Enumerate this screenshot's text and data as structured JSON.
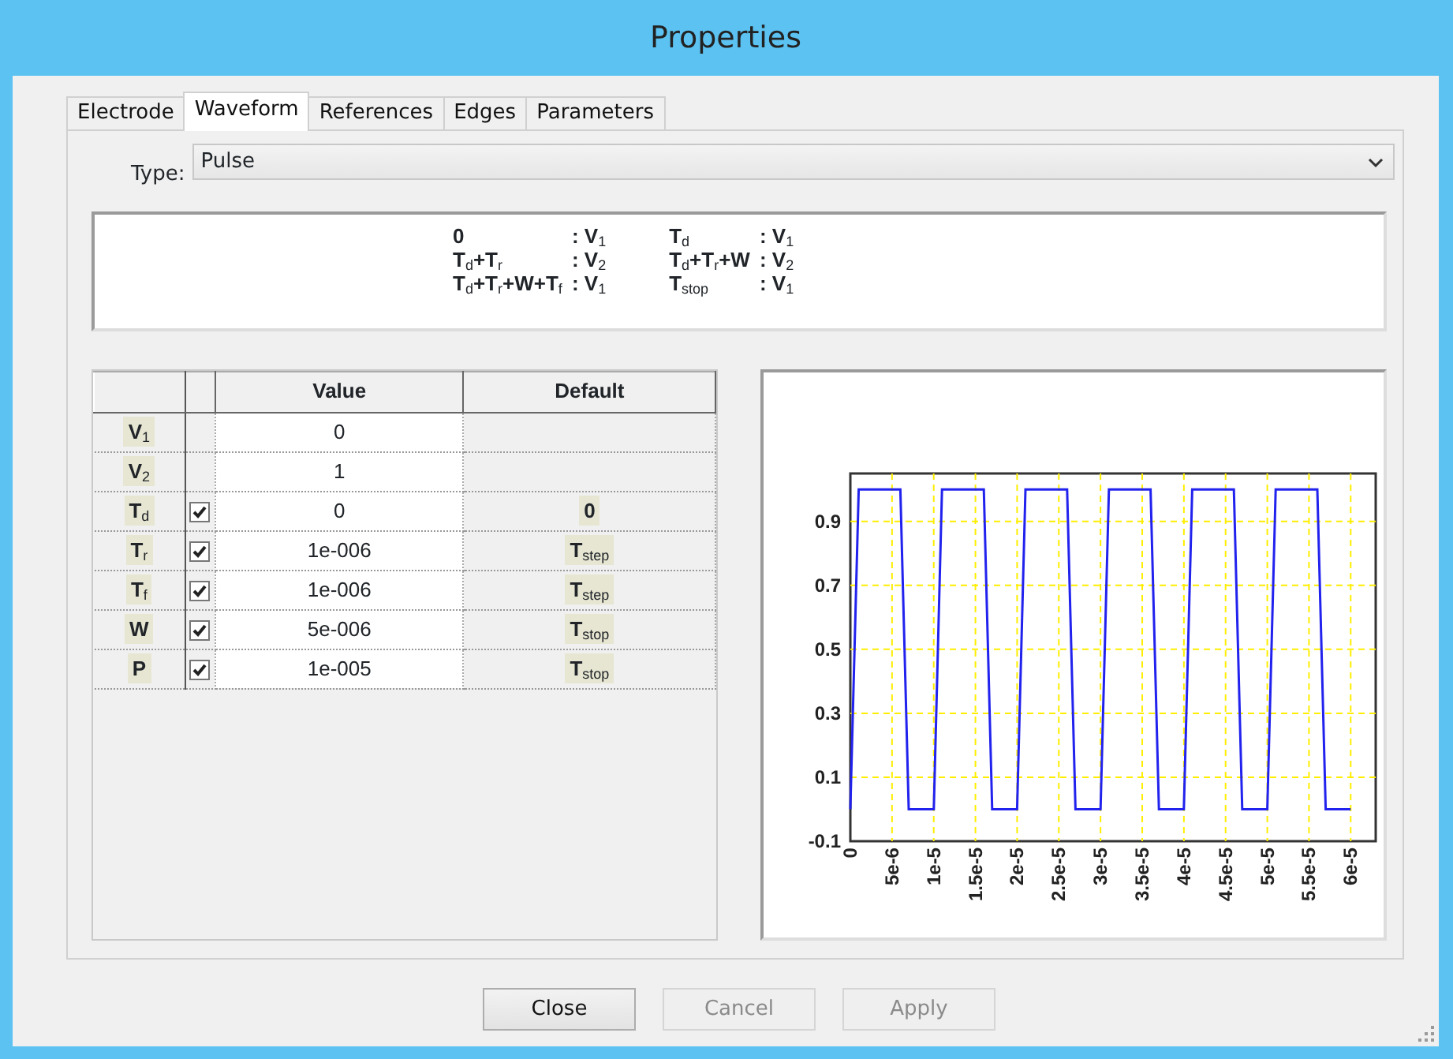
{
  "window": {
    "title": "Properties"
  },
  "tabs": [
    {
      "label": "Electrode",
      "selected": false
    },
    {
      "label": "Waveform",
      "selected": true
    },
    {
      "label": "References",
      "selected": false
    },
    {
      "label": "Edges",
      "selected": false
    },
    {
      "label": "Parameters",
      "selected": false
    }
  ],
  "type_field": {
    "label": "Type:",
    "value": "Pulse"
  },
  "formulas": [
    [
      {
        "time": "0",
        "level": ": V$_{1}$"
      },
      {
        "time": "T$_{d}$+T$_{r}$",
        "level": ": V$_{2}$"
      },
      {
        "time": "T$_{d}$+T$_{r}$+W+T$_{f}$",
        "level": ": V$_{1}$"
      }
    ],
    [
      {
        "time": "T$_{d}$",
        "level": ": V$_{1}$"
      },
      {
        "time": "T$_{d}$+T$_{r}$+W",
        "level": ": V$_{2}$"
      },
      {
        "time": "T$_{stop}$",
        "level": ": V$_{1}$"
      }
    ]
  ],
  "table": {
    "columns": [
      "Value",
      "Default"
    ],
    "rows": [
      {
        "name": "V$_{1}$",
        "kind": "plain",
        "value": "0"
      },
      {
        "name": "V$_{2}$",
        "kind": "plain",
        "value": "1"
      },
      {
        "name": "T$_{d}$",
        "kind": "checkbox",
        "checked": true,
        "value": "0",
        "default": "0"
      },
      {
        "name": "T$_{r}$",
        "kind": "checkbox",
        "checked": true,
        "value": "1e-006",
        "default": "T$_{step}$"
      },
      {
        "name": "T$_{f}$",
        "kind": "checkbox",
        "checked": true,
        "value": "1e-006",
        "default": "T$_{step}$"
      },
      {
        "name": "W",
        "kind": "checkbox",
        "checked": true,
        "value": "5e-006",
        "default": "T$_{stop}$"
      },
      {
        "name": "P",
        "kind": "checkbox",
        "checked": true,
        "value": "1e-005",
        "default": "T$_{stop}$"
      }
    ]
  },
  "chart": {
    "chart_data": {
      "type": "line",
      "x": [
        0,
        1e-06,
        6e-06,
        7e-06,
        1e-05,
        1.1e-05,
        1.6e-05,
        1.7e-05,
        2e-05,
        2.1e-05,
        2.6e-05,
        2.7e-05,
        3e-05,
        3.1e-05,
        3.6e-05,
        3.7e-05,
        4e-05,
        4.1e-05,
        4.6e-05,
        4.7e-05,
        5e-05,
        5.1e-05,
        5.6e-05,
        5.7e-05,
        6e-05
      ],
      "grid": true,
      "series": [
        {
          "color": "#2222ee",
          "values": [
            0,
            1,
            1,
            0,
            0,
            1,
            1,
            0,
            0,
            1,
            1,
            0,
            0,
            1,
            1,
            0,
            0,
            1,
            1,
            0,
            0,
            1,
            1,
            0,
            0
          ]
        }
      ],
      "xlim": [
        0,
        6.3e-05
      ],
      "ylim": [
        -0.1,
        1.05
      ],
      "xticks": [
        {
          "value": 0,
          "label": "0"
        },
        {
          "value": 5e-06,
          "label": "5e-6"
        },
        {
          "value": 1e-05,
          "label": "1e-5"
        },
        {
          "value": 1.5e-05,
          "label": "1.5e-5"
        },
        {
          "value": 2e-05,
          "label": "2e-5"
        },
        {
          "value": 2.5e-05,
          "label": "2.5e-5"
        },
        {
          "value": 3e-05,
          "label": "3e-5"
        },
        {
          "value": 3.5e-05,
          "label": "3.5e-5"
        },
        {
          "value": 4e-05,
          "label": "4e-5"
        },
        {
          "value": 4.5e-05,
          "label": "4.5e-5"
        },
        {
          "value": 5e-05,
          "label": "5e-5"
        },
        {
          "value": 5.5e-05,
          "label": "5.5e-5"
        },
        {
          "value": 6e-05,
          "label": "6e-5"
        }
      ],
      "yticks": [
        -0.1,
        0.1,
        0.3,
        0.5,
        0.7,
        0.9
      ]
    }
  },
  "buttons": [
    {
      "label": "Close",
      "disabled": false
    },
    {
      "label": "Cancel",
      "disabled": true
    },
    {
      "label": "Apply",
      "disabled": true
    }
  ]
}
